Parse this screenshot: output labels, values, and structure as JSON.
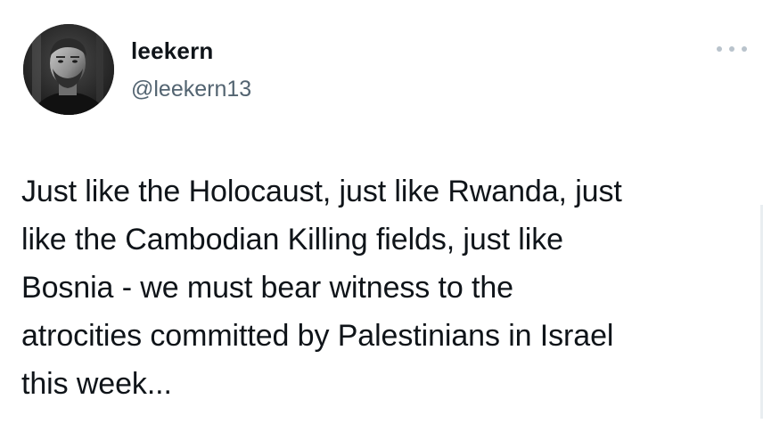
{
  "tweet": {
    "display_name": "leekern",
    "handle": "@leekern13",
    "text": "Just like the Holocaust, just like Rwanda, just\nlike the Cambodian Killing fields, just like\nBosnia - we must bear witness to the\natrocities committed by Palestinians in Israel\nthis week...",
    "more_icon": "more-horizontal-icon"
  },
  "colors": {
    "text": "#0f1419",
    "secondary": "#536471",
    "more_dots": "#b9c3cc"
  }
}
